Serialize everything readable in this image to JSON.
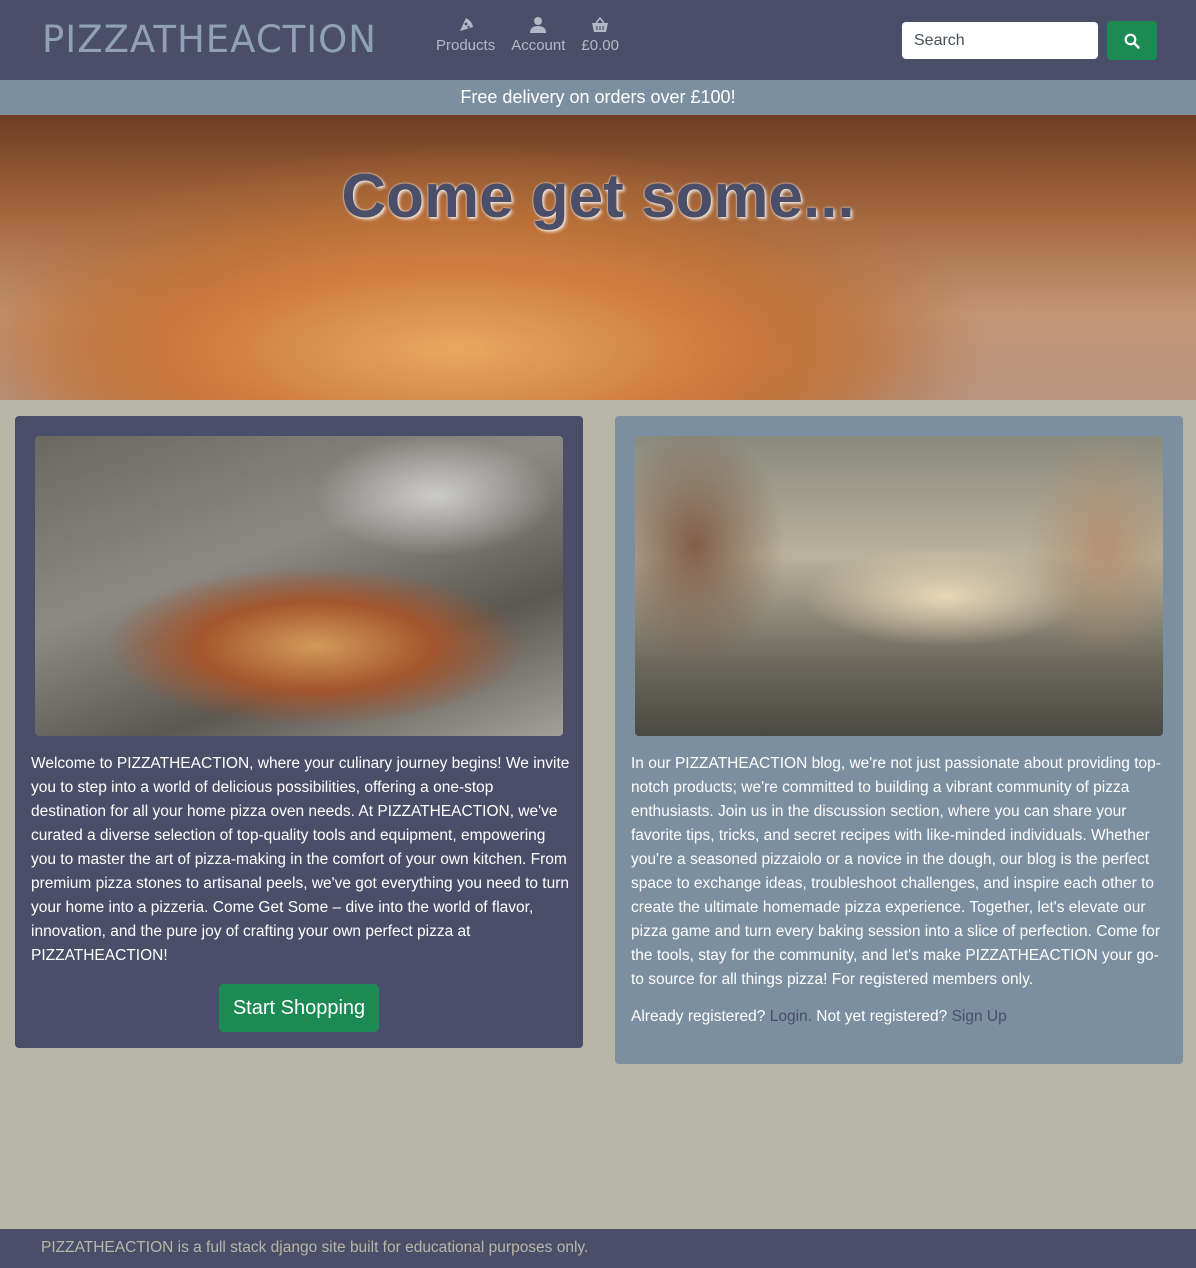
{
  "header": {
    "logo": "PIZZATHEACTION",
    "nav": [
      {
        "label": "Products",
        "icon": "pizza-slice-icon"
      },
      {
        "label": "Account",
        "icon": "user-icon"
      },
      {
        "label": "£0.00",
        "icon": "basket-icon"
      }
    ],
    "search": {
      "placeholder": "Search"
    }
  },
  "banner": {
    "text": "Free delivery on orders over £100!"
  },
  "hero": {
    "title": "Come get some..."
  },
  "cards": {
    "left": {
      "text": "Welcome to PIZZATHEACTION, where your culinary journey begins! We invite you to step into a world of delicious possibilities, offering a one-stop destination for all your home pizza oven needs. At PIZZATHEACTION, we've curated a diverse selection of top-quality tools and equipment, empowering you to master the art of pizza-making in the comfort of your own kitchen. From premium pizza stones to artisanal peels, we've got everything you need to turn your home into a pizzeria. Come Get Some – dive into the world of flavor, innovation, and the pure joy of crafting your own perfect pizza at PIZZATHEACTION!",
      "button": "Start Shopping"
    },
    "right": {
      "text": "In our PIZZATHEACTION blog, we're not just passionate about providing top-notch products; we're committed to building a vibrant community of pizza enthusiasts. Join us in the discussion section, where you can share your favorite tips, tricks, and secret recipes with like-minded individuals. Whether you're a seasoned pizzaiolo or a novice in the dough, our blog is the perfect space to exchange ideas, troubleshoot challenges, and inspire each other to create the ultimate homemade pizza experience. Together, let's elevate our pizza game and turn every baking session into a slice of perfection. Come for the tools, stay for the community, and let's make PIZZATHEACTION your go-to source for all things pizza! For registered members only.",
      "already": "Already registered?",
      "login": "Login.",
      "notyet": "Not yet registered?",
      "signup": "Sign Up"
    }
  },
  "footer": {
    "text": "PIZZATHEACTION is a full stack django site built for educational purposes only."
  },
  "colors": {
    "primary": "#4b4e68",
    "secondary": "#7b8fa0",
    "background": "#b8b6a6",
    "accent": "#1b8a53"
  }
}
